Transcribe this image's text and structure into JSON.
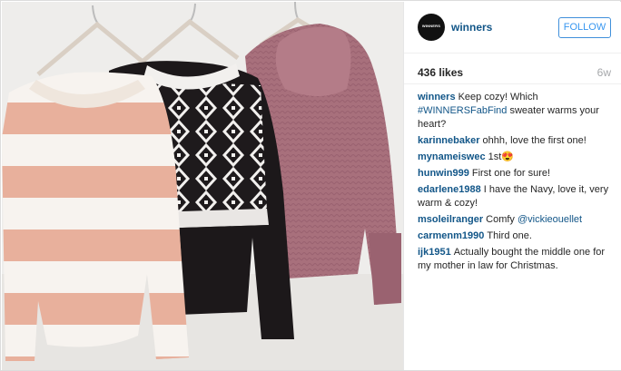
{
  "post": {
    "account": {
      "avatar_text": "WINNERS",
      "username": "winners",
      "follow_label": "FOLLOW"
    },
    "likes": "436 likes",
    "age": "6w",
    "caption": {
      "author": "winners",
      "text_before": "Keep cozy! Which ",
      "hashtag": "#WINNERSFabFind",
      "text_after": " sweater warms your heart?"
    },
    "comments": [
      {
        "author": "karinnebaker",
        "text": "ohhh, love the first one!"
      },
      {
        "author": "mynameiswec",
        "text": "1st😍"
      },
      {
        "author": "hunwin999",
        "text": "First one for sure!"
      },
      {
        "author": "edarlene1988",
        "text": "I have the Navy, love it, very warm & cozy!"
      },
      {
        "author": "msoleilranger",
        "text": "Comfy ",
        "mention": "@vickieouellet"
      },
      {
        "author": "carmenm1990",
        "text": "Third one."
      },
      {
        "author": "ijk1951",
        "text": "Actually bought the middle one for my mother in law for Christmas."
      }
    ]
  },
  "colors": {
    "link": "#125688",
    "follow_blue": "#3897f0",
    "muted": "#a5a7aa"
  }
}
